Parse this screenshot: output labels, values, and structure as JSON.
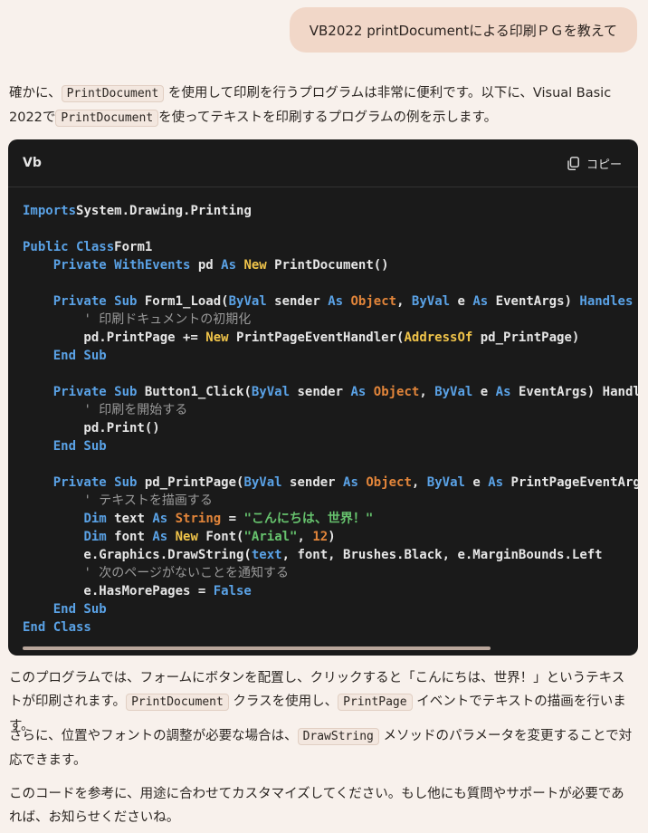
{
  "user_message": "VB2022 printDocumentによる印刷ＰＧを教えて",
  "intro": {
    "t1": "確かに、",
    "c1": "PrintDocument",
    "t2": " を使用して印刷を行うプログラムは非常に便利です。以下に、Visual Basic 2022で",
    "c2": "PrintDocument",
    "t3": "を使ってテキストを印刷するプログラムの例を示します。"
  },
  "code_block": {
    "language": "Vb",
    "copy_label": "コピー",
    "lines": [
      [
        [
          "kw",
          "Imports"
        ],
        [
          "",
          "System.Drawing.Printing"
        ]
      ],
      [],
      [
        [
          "kw",
          "Public Class"
        ],
        [
          "",
          "Form1"
        ]
      ],
      [
        [
          "",
          "    "
        ],
        [
          "kw",
          "Private WithEvents"
        ],
        [
          "",
          " pd "
        ],
        [
          "kw",
          "As"
        ],
        [
          "",
          " "
        ],
        [
          "nw",
          "New"
        ],
        [
          "",
          " PrintDocument()"
        ]
      ],
      [],
      [
        [
          "",
          "    "
        ],
        [
          "kw",
          "Private Sub"
        ],
        [
          "",
          " Form1_Load("
        ],
        [
          "kw",
          "ByVal"
        ],
        [
          "",
          " sender "
        ],
        [
          "kw",
          "As"
        ],
        [
          "",
          " "
        ],
        [
          "ob",
          "Object"
        ],
        [
          "",
          ", "
        ],
        [
          "kw",
          "ByVal"
        ],
        [
          "",
          " e "
        ],
        [
          "kw",
          "As"
        ],
        [
          "",
          " EventArgs) "
        ],
        [
          "kw",
          "Handles"
        ]
      ],
      [
        [
          "",
          "        "
        ],
        [
          "cm",
          "' 印刷ドキュメントの初期化"
        ]
      ],
      [
        [
          "",
          "        pd.PrintPage += "
        ],
        [
          "nw",
          "New"
        ],
        [
          "",
          " PrintPageEventHandler("
        ],
        [
          "nw",
          "AddressOf"
        ],
        [
          "",
          " pd_PrintPage)"
        ]
      ],
      [
        [
          "",
          "    "
        ],
        [
          "kw",
          "End Sub"
        ]
      ],
      [],
      [
        [
          "",
          "    "
        ],
        [
          "kw",
          "Private Sub"
        ],
        [
          "",
          " Button1_Click("
        ],
        [
          "kw",
          "ByVal"
        ],
        [
          "",
          " sender "
        ],
        [
          "kw",
          "As"
        ],
        [
          "",
          " "
        ],
        [
          "ob",
          "Object"
        ],
        [
          "",
          ", "
        ],
        [
          "kw",
          "ByVal"
        ],
        [
          "",
          " e "
        ],
        [
          "kw",
          "As"
        ],
        [
          "",
          " EventArgs) Handles"
        ]
      ],
      [
        [
          "",
          "        "
        ],
        [
          "cm",
          "' 印刷を開始する"
        ]
      ],
      [
        [
          "",
          "        pd.Print()"
        ]
      ],
      [
        [
          "",
          "    "
        ],
        [
          "kw",
          "End Sub"
        ]
      ],
      [],
      [
        [
          "",
          "    "
        ],
        [
          "kw",
          "Private Sub"
        ],
        [
          "",
          " pd_PrintPage("
        ],
        [
          "kw",
          "ByVal"
        ],
        [
          "",
          " sender "
        ],
        [
          "kw",
          "As"
        ],
        [
          "",
          " "
        ],
        [
          "ob",
          "Object"
        ],
        [
          "",
          ", "
        ],
        [
          "kw",
          "ByVal"
        ],
        [
          "",
          " e "
        ],
        [
          "kw",
          "As"
        ],
        [
          "",
          " PrintPageEventArgs)"
        ]
      ],
      [
        [
          "",
          "        "
        ],
        [
          "cm",
          "' テキストを描画する"
        ]
      ],
      [
        [
          "",
          "        "
        ],
        [
          "kw",
          "Dim"
        ],
        [
          "",
          " text "
        ],
        [
          "kw",
          "As"
        ],
        [
          "",
          " "
        ],
        [
          "ob",
          "String"
        ],
        [
          "",
          " = "
        ],
        [
          "st",
          "\"こんにちは、世界！\""
        ]
      ],
      [
        [
          "",
          "        "
        ],
        [
          "kw",
          "Dim"
        ],
        [
          "",
          " font "
        ],
        [
          "kw",
          "As"
        ],
        [
          "",
          " "
        ],
        [
          "nw",
          "New"
        ],
        [
          "",
          " Font("
        ],
        [
          "st",
          "\"Arial\""
        ],
        [
          "",
          ", "
        ],
        [
          "nm",
          "12"
        ],
        [
          "",
          ")"
        ]
      ],
      [
        [
          "",
          "        e.Graphics.DrawString("
        ],
        [
          "kw",
          "text"
        ],
        [
          "",
          ", font, Brushes.Black, e.MarginBounds.Left"
        ]
      ],
      [
        [
          "",
          "        "
        ],
        [
          "cm",
          "' 次のページがないことを通知する"
        ]
      ],
      [
        [
          "",
          "        e.HasMorePages = "
        ],
        [
          "kw",
          "False"
        ]
      ],
      [
        [
          "",
          "    "
        ],
        [
          "kw",
          "End Sub"
        ]
      ],
      [
        [
          "kw",
          "End Class"
        ]
      ]
    ]
  },
  "after1": {
    "t1": "このプログラムでは、フォームにボタンを配置し、クリックすると「こんにちは、世界！」というテキストが印刷されます。",
    "c1": "PrintDocument",
    "t2": " クラスを使用し、",
    "c2": "PrintPage",
    "t3": " イベントでテキストの描画を行います。"
  },
  "after2": {
    "t1": "さらに、位置やフォントの調整が必要な場合は、",
    "c1": "DrawString",
    "t2": " メソッドのパラメータを変更することで対応できます。"
  },
  "after3": {
    "t1": "このコードを参考に、用途に合わせてカスタマイズしてください。もし他にも質問やサポートが必要であれば、お知らせくださいね。"
  }
}
